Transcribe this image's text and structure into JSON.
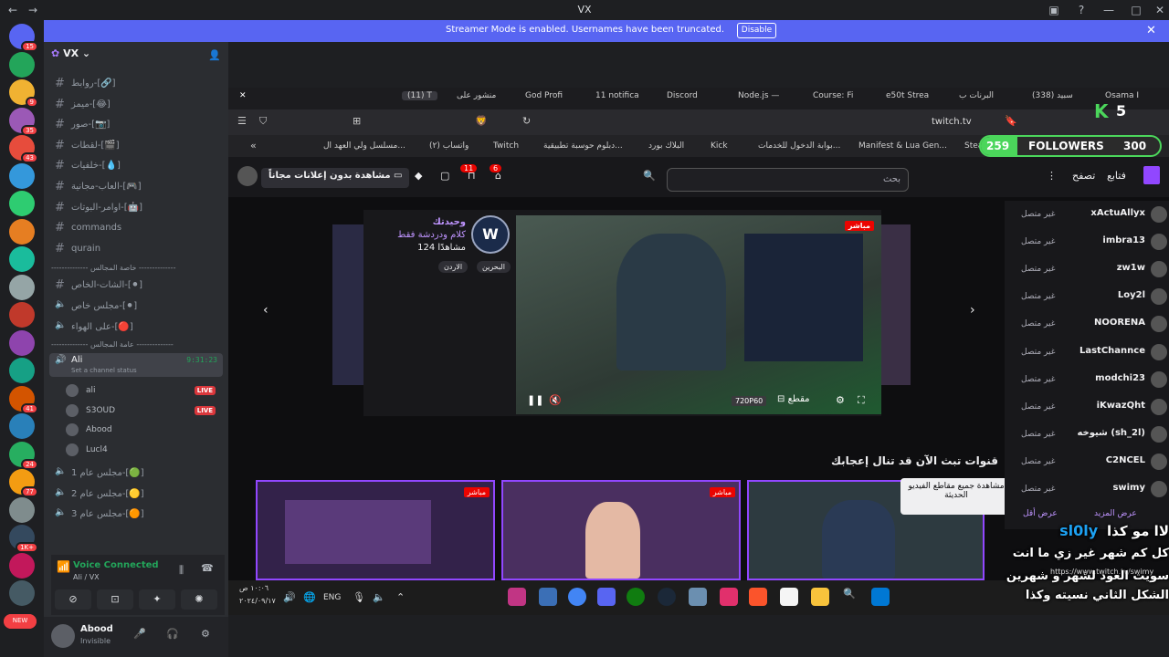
{
  "window": {
    "title": "VX"
  },
  "banner": {
    "message": "Streamer Mode is enabled. Usernames have been truncated.",
    "button": "Disable"
  },
  "guild_badges": [
    "15",
    "",
    "9",
    "35",
    "43",
    "",
    "",
    "",
    "",
    "",
    "",
    "",
    "",
    "41",
    "",
    "24",
    "77",
    "",
    "1K+",
    "",
    "",
    "NEW"
  ],
  "server": {
    "name": "VX"
  },
  "channels": [
    {
      "name": "روابط-[🔗]",
      "type": "text"
    },
    {
      "name": "ميمز-[😂]",
      "type": "text"
    },
    {
      "name": "صور-[📷]",
      "type": "text"
    },
    {
      "name": "لقطات-[🎬]",
      "type": "text"
    },
    {
      "name": "خلفيات-[💧]",
      "type": "text"
    },
    {
      "name": "العاب-مجانية-[🎮]",
      "type": "text"
    },
    {
      "name": "اوامر-البوتات-[🤖]",
      "type": "text"
    },
    {
      "name": "commands",
      "type": "text"
    },
    {
      "name": "qurain",
      "type": "text"
    }
  ],
  "category_private": "-------------- خاصة المجالس --------------",
  "private_channels": [
    {
      "name": "الشات-الخاص-[⚫]",
      "type": "text"
    },
    {
      "name": "مجلس خاص-[⚫]",
      "type": "voice"
    },
    {
      "name": "على الهواء-[🔴]",
      "type": "voice"
    }
  ],
  "category_public": "-------------- عامة المجالس --------------",
  "voice_active": {
    "name": "Ali",
    "time": "9:31:23",
    "status_hint": "Set a channel status"
  },
  "voice_users": [
    {
      "name": "ali",
      "live": "LIVE"
    },
    {
      "name": "S3OUD",
      "live": "LIVE"
    },
    {
      "name": "Abood",
      "live": ""
    },
    {
      "name": "Lucl4",
      "live": ""
    }
  ],
  "public_channels": [
    {
      "name": "مجلس عام 1-[🟢]"
    },
    {
      "name": "مجلس عام 2-[🟡]"
    },
    {
      "name": "مجلس عام 3-[🟠]"
    }
  ],
  "voice_connected": {
    "label": "Voice Connected",
    "sub": "Ali / VX"
  },
  "user": {
    "name": "Abood",
    "status": "Invisible"
  },
  "browser_tabs": [
    "(11) T",
    "منشور على",
    "God Profi",
    "11 notifica",
    "Discord",
    "Node.js —",
    "Course: Fi",
    "e50t Strea",
    "البرنات ب",
    "(338) سبيد",
    "Osama I"
  ],
  "address": "twitch.tv",
  "bookmarks": [
    "مسلسل ولي العهد ال...",
    "(٢) واتساب",
    "Twitch",
    "دبلوم حوسبة تطبيقية...",
    "البلاك بورد",
    "Kick",
    "بوابة الدخول للخدمات...",
    "Manifest & Lua Gen...",
    "Stea"
  ],
  "twitch_nav": {
    "follow": "فتابع",
    "browse": "تصفح",
    "search_placeholder": "بحث",
    "ad_free": "مشاهدة بدون إعلانات مجاناً",
    "badge1": "11",
    "badge2": "6"
  },
  "featured": {
    "streamer": "وحيدتك",
    "title": "كلام ودردشة فقط",
    "viewers": "124 مشاهدًا",
    "tags": [
      "البحرين",
      "الاردن"
    ],
    "live": "مباشر",
    "quality": "720P60",
    "clip": "مقطع"
  },
  "recommended_title": "قنوات تبث الآن قد تنال إعجابك",
  "thumb_live": "مباشر",
  "tooltip": "مشاهدة جميع مقاطع الفيديو الحديثة",
  "followers": {
    "count": "259",
    "label": "FOLLOWERS",
    "goal": "300",
    "k_count": "5"
  },
  "chat_rows": [
    {
      "name": "xActuAllyx",
      "status": "غير متصل"
    },
    {
      "name": "imbra13",
      "status": "غير متصل"
    },
    {
      "name": "zw1w",
      "status": "غير متصل"
    },
    {
      "name": "Loy2l",
      "status": "غير متصل"
    },
    {
      "name": "NOORENA",
      "status": "غير متصل"
    },
    {
      "name": "LastChannce",
      "status": "غير متصل"
    },
    {
      "name": "modchi23",
      "status": "غير متصل"
    },
    {
      "name": "iKwazQht",
      "status": "غير متصل"
    },
    {
      "name": "شيوخه (sh_2l)",
      "status": "غير متصل"
    },
    {
      "name": "C2NCEL",
      "status": "غير متصل"
    },
    {
      "name": "swimy",
      "status": "غير متصل"
    }
  ],
  "show_less": "عرض أقل",
  "show_more": "عرض المزيد",
  "url_hint": "https://www.twitch.tv/swimy",
  "subtitle": {
    "name": "sl0ly",
    "line1": "لاا مو كذا",
    "line2": "كل كم شهر غير زي ما انت",
    "line3": "سويت العود لشهر و شهرين",
    "line4": "الشكل الثاني نسيته وكذا"
  },
  "clock": {
    "time": "١٠:٠٦ ص",
    "date": "٢٠٢٤/٠٩/١٧",
    "lang": "ENG"
  }
}
